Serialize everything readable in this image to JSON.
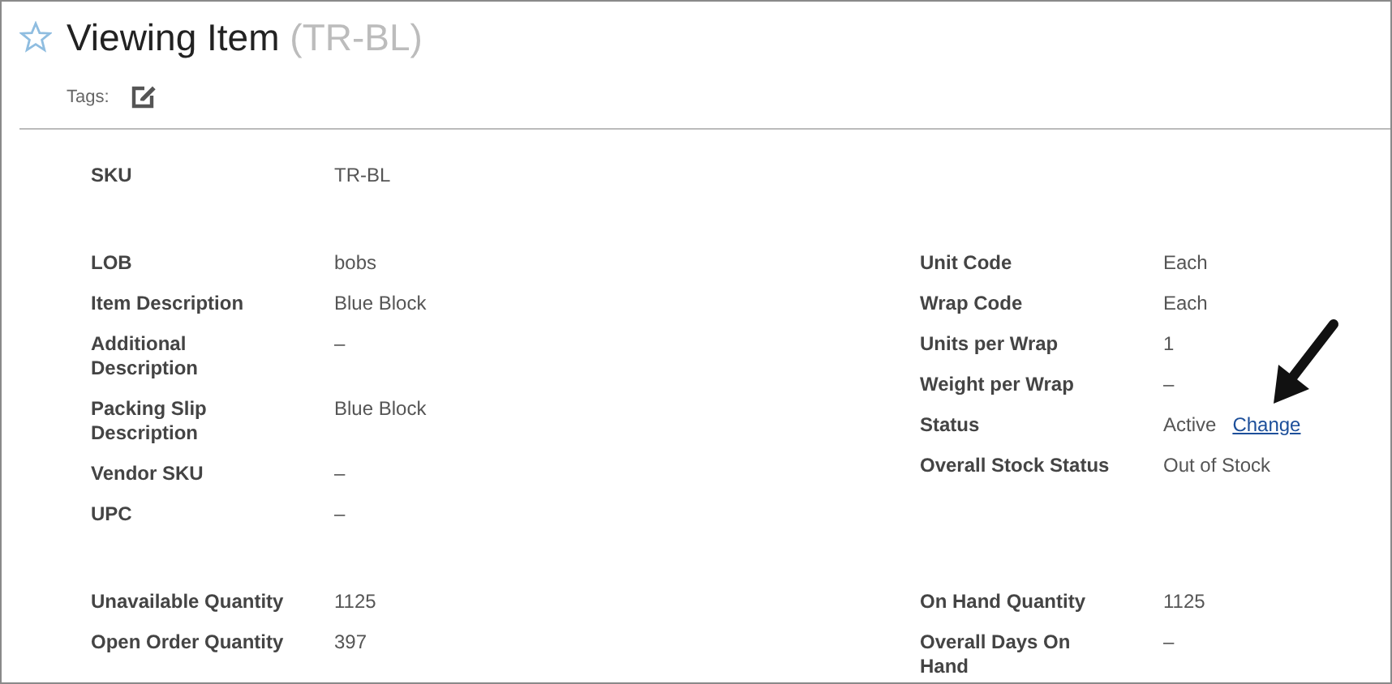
{
  "header": {
    "title": "Viewing Item",
    "code": "(TR-BL)",
    "tags_label": "Tags:"
  },
  "sections": [
    {
      "left": [
        {
          "label": "SKU",
          "value": "TR-BL"
        }
      ]
    },
    {
      "left": [
        {
          "label": "LOB",
          "value": "bobs"
        },
        {
          "label": "Item Description",
          "value": "Blue Block"
        },
        {
          "label": "Additional Description",
          "value": "–"
        },
        {
          "label": "Packing Slip Description",
          "value": "Blue Block"
        },
        {
          "label": "Vendor SKU",
          "value": "–"
        },
        {
          "label": "UPC",
          "value": "–"
        }
      ],
      "right": [
        {
          "label": "Unit Code",
          "value": "Each"
        },
        {
          "label": "Wrap Code",
          "value": "Each"
        },
        {
          "label": "Units per Wrap",
          "value": "1"
        },
        {
          "label": "Weight per Wrap",
          "value": "–"
        },
        {
          "label": "Status",
          "value": "Active",
          "link": "Change"
        },
        {
          "label": "Overall Stock Status",
          "value": "Out of Stock"
        }
      ]
    },
    {
      "left": [
        {
          "label": "Unavailable Quantity",
          "value": "1125"
        },
        {
          "label": "Open Order Quantity",
          "value": "397"
        }
      ],
      "right": [
        {
          "label": "On Hand Quantity",
          "value": "1125"
        },
        {
          "label": "Overall Days On Hand",
          "value": "–"
        }
      ]
    }
  ]
}
